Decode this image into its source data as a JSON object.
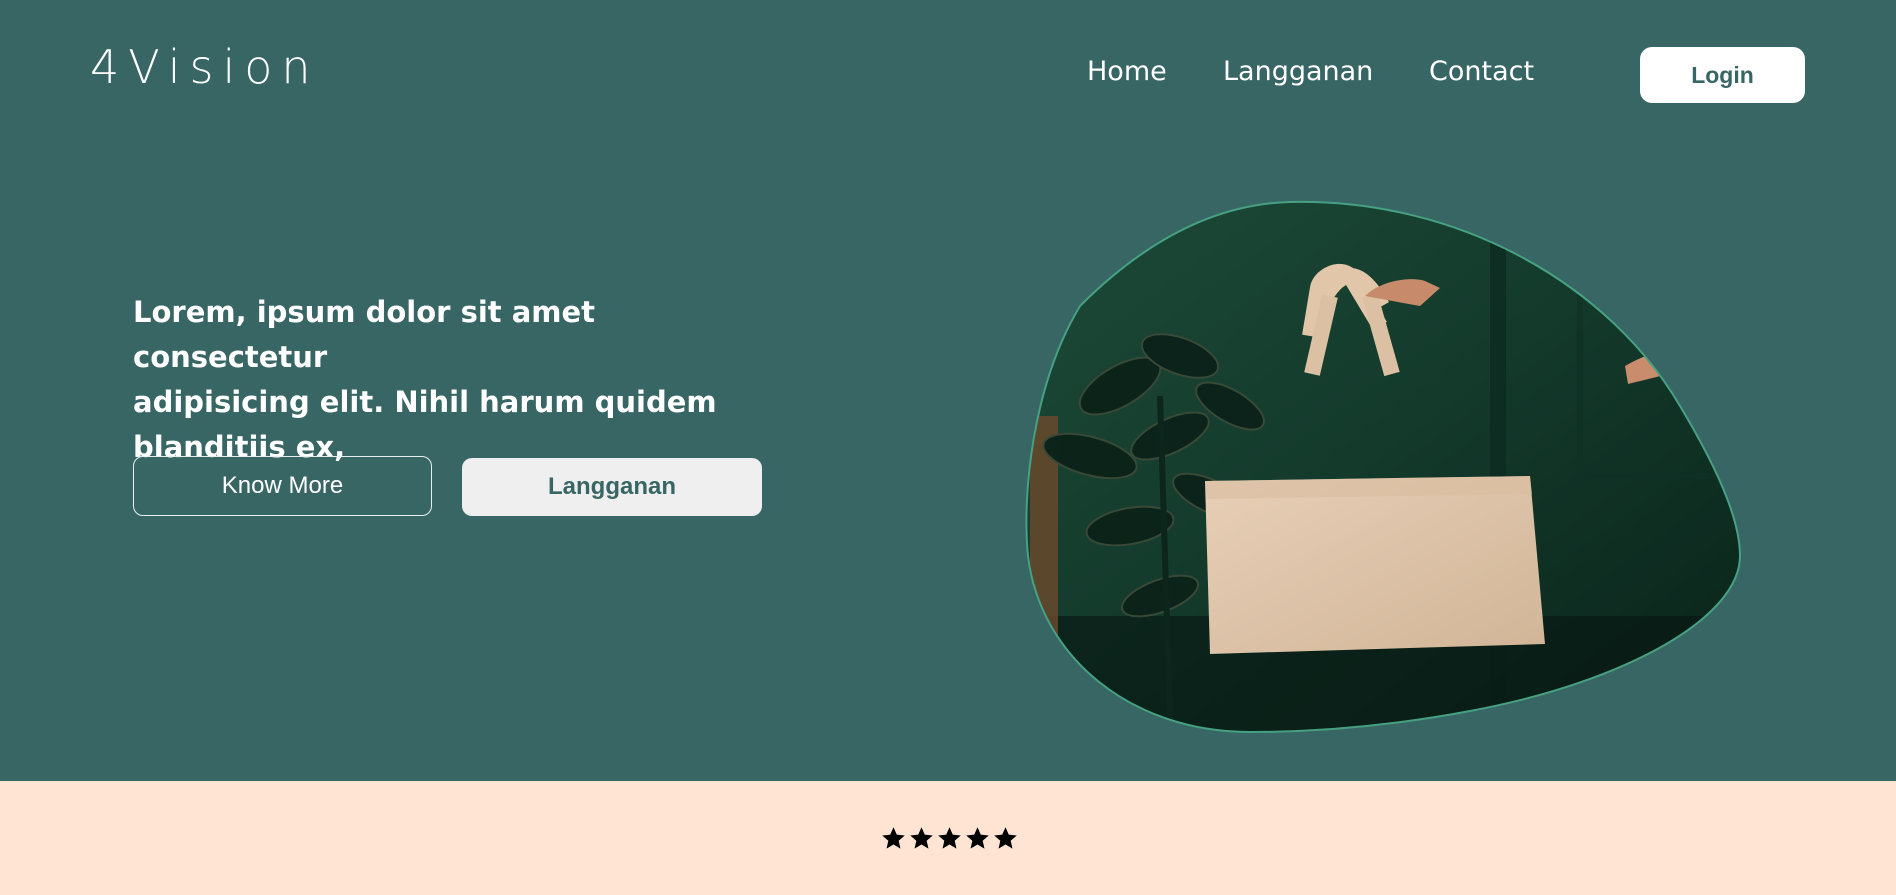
{
  "brand": {
    "logo_text": "4Vision"
  },
  "nav": {
    "items": [
      {
        "label": "Home"
      },
      {
        "label": "Langganan"
      },
      {
        "label": "Contact"
      }
    ],
    "login_label": "Login"
  },
  "hero": {
    "headline_line1": "Lorem, ipsum dolor sit amet consectetur",
    "headline_line2": "adipisicing elit. Nihil harum quidem",
    "headline_line3": "blanditiis ex,",
    "know_more_label": "Know More",
    "subscribe_label": "Langganan",
    "image_subject": "hand holding beige tote bag"
  },
  "rating": {
    "stars": 5,
    "max": 5
  },
  "colors": {
    "hero_bg": "#386664",
    "strip_bg": "#ffe4d4",
    "button_light": "#efefef",
    "text_light": "#ffffff"
  }
}
